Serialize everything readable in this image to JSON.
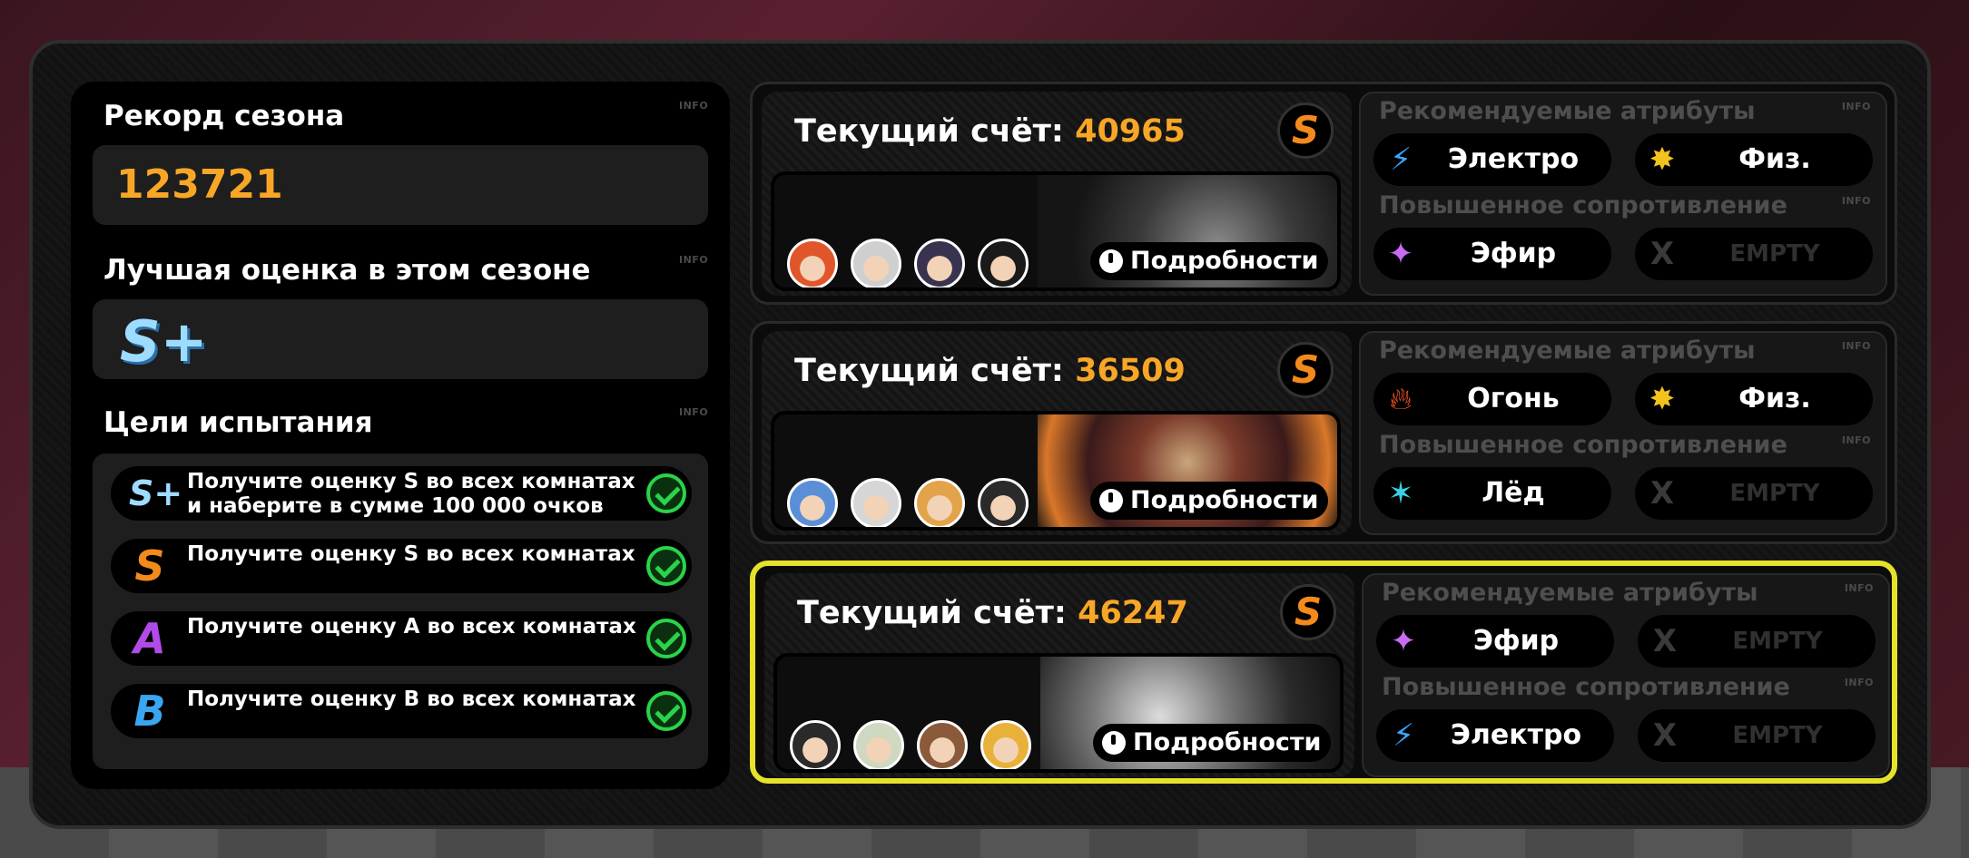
{
  "colors": {
    "accent_score": "#f7a626",
    "selected_border": "#e6e22a",
    "check_green": "#29d34a",
    "rank_s_orange": "#f38a1c"
  },
  "left_panel": {
    "season_record": {
      "heading": "Рекорд сезона",
      "info": "INFO",
      "value": "123721"
    },
    "best_rank": {
      "heading": "Лучшая оценка в этом сезоне",
      "info": "INFO",
      "rank": "S+"
    },
    "goals": {
      "heading": "Цели испытания",
      "info": "INFO",
      "items": [
        {
          "rank": "S+",
          "rank_color": "#9edcff",
          "text": "Получите оценку S во всех комнатах и наберите в сумме 100 000 очков",
          "done": true
        },
        {
          "rank": "S",
          "rank_color": "#f38a1c",
          "text": "Получите оценку S во всех комнатах",
          "done": true
        },
        {
          "rank": "A",
          "rank_color": "#b04ae8",
          "text": "Получите оценку A во всех комнатах",
          "done": true
        },
        {
          "rank": "B",
          "rank_color": "#3aa6f0",
          "text": "Получите оценку B во всех комнатах",
          "done": true
        }
      ]
    }
  },
  "runs": [
    {
      "score_label": "Текущий счёт:",
      "score": "40965",
      "rank": "S",
      "details_label": "Подробности",
      "recommended": {
        "heading": "Рекомендуемые атрибуты",
        "info": "INFO",
        "attrs": [
          {
            "name": "Электро",
            "icon": "electric-icon"
          },
          {
            "name": "Физ.",
            "icon": "physical-icon"
          }
        ]
      },
      "resistance": {
        "heading": "Повышенное сопротивление",
        "info": "INFO",
        "attrs": [
          {
            "name": "Эфир",
            "icon": "ether-icon"
          },
          {
            "name": "EMPTY",
            "icon": "empty-x-icon"
          }
        ]
      }
    },
    {
      "score_label": "Текущий счёт:",
      "score": "36509",
      "rank": "S",
      "details_label": "Подробности",
      "recommended": {
        "heading": "Рекомендуемые атрибуты",
        "info": "INFO",
        "attrs": [
          {
            "name": "Огонь",
            "icon": "fire-icon"
          },
          {
            "name": "Физ.",
            "icon": "physical-icon"
          }
        ]
      },
      "resistance": {
        "heading": "Повышенное сопротивление",
        "info": "INFO",
        "attrs": [
          {
            "name": "Лёд",
            "icon": "ice-icon"
          },
          {
            "name": "EMPTY",
            "icon": "empty-x-icon"
          }
        ]
      }
    },
    {
      "score_label": "Текущий счёт:",
      "score": "46247",
      "rank": "S",
      "details_label": "Подробности",
      "recommended": {
        "heading": "Рекомендуемые атрибуты",
        "info": "INFO",
        "attrs": [
          {
            "name": "Эфир",
            "icon": "ether-icon"
          },
          {
            "name": "EMPTY",
            "icon": "empty-x-icon"
          }
        ]
      },
      "resistance": {
        "heading": "Повышенное сопротивление",
        "info": "INFO",
        "attrs": [
          {
            "name": "Электро",
            "icon": "electric-icon"
          },
          {
            "name": "EMPTY",
            "icon": "empty-x-icon"
          }
        ]
      }
    }
  ]
}
